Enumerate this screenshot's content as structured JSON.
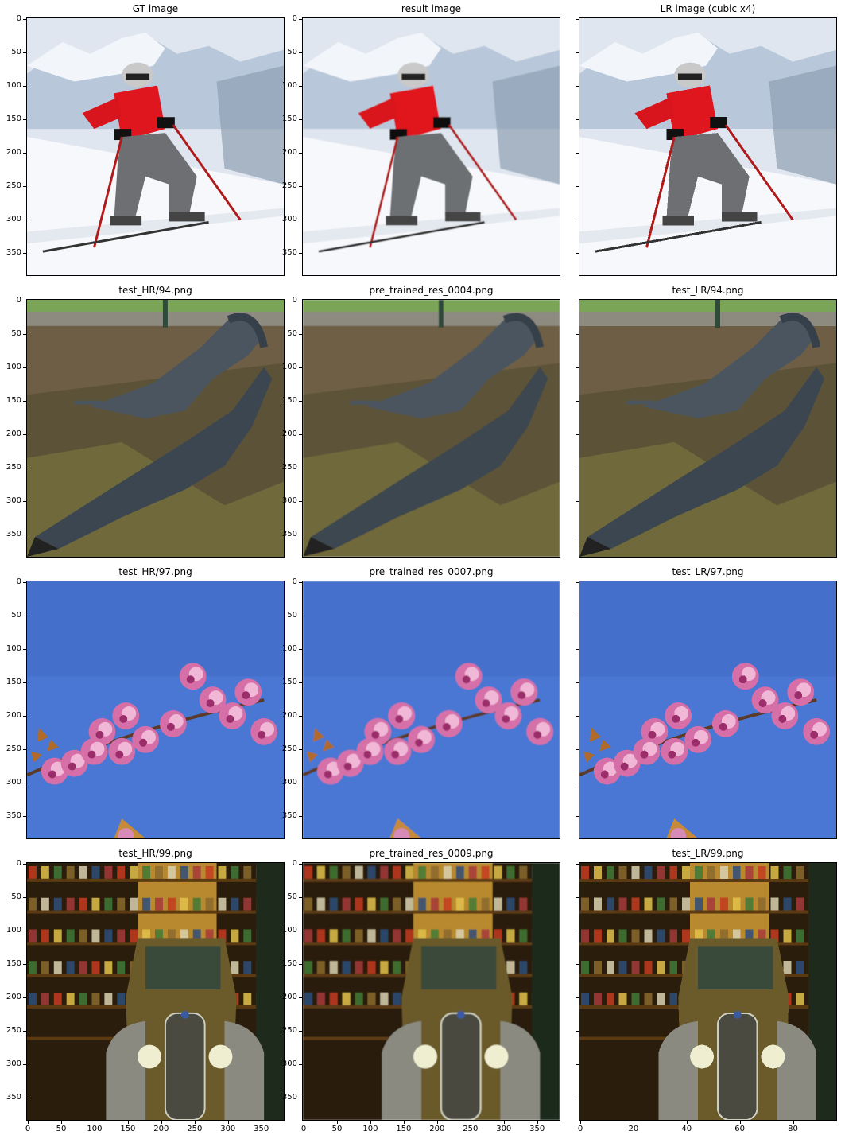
{
  "figure": {
    "rows": [
      {
        "titles": [
          "GT image",
          "result image",
          "LR image (cubic x4)"
        ],
        "scene": "skier"
      },
      {
        "titles": [
          "test_HR/94.png",
          "pre_trained_res_0004.png",
          "test_LR/94.png"
        ],
        "scene": "gharials"
      },
      {
        "titles": [
          "test_HR/97.png",
          "pre_trained_res_0007.png",
          "test_LR/97.png"
        ],
        "scene": "blossom"
      },
      {
        "titles": [
          "test_HR/99.png",
          "pre_trained_res_0009.png",
          "test_LR/99.png"
        ],
        "scene": "garage"
      }
    ],
    "y_ticks": [
      "0",
      "50",
      "100",
      "150",
      "200",
      "250",
      "300",
      "350"
    ],
    "x_ticks_hr": [
      "0",
      "50",
      "100",
      "150",
      "200",
      "250",
      "300",
      "350"
    ],
    "x_ticks_lr": [
      "0",
      "20",
      "40",
      "60",
      "80"
    ]
  }
}
